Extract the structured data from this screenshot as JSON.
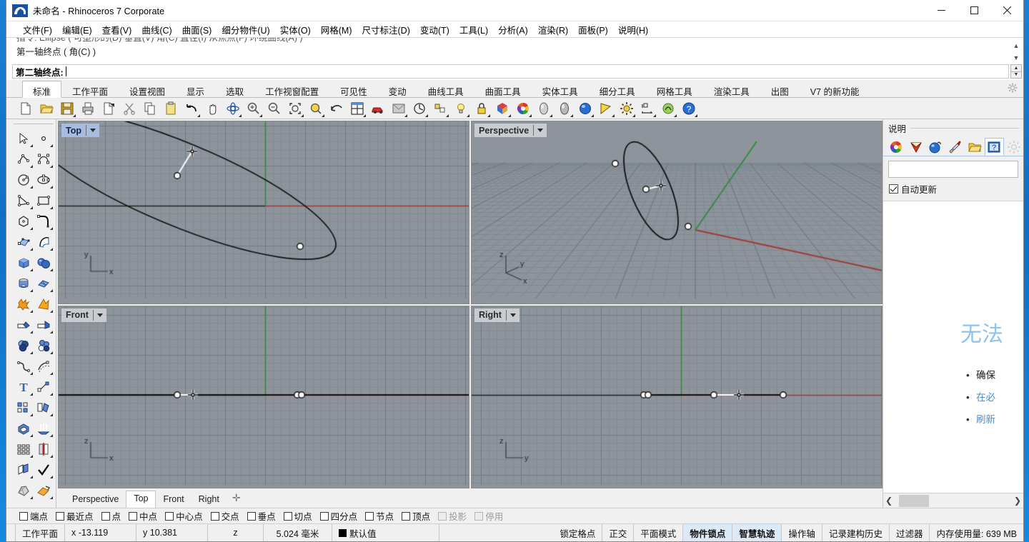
{
  "window": {
    "title": "未命名 - Rhinoceros 7 Corporate",
    "minimize": "—",
    "maximize": "□",
    "close": "✕"
  },
  "menubar": {
    "items": [
      {
        "label": "文件(F)",
        "name": "menu-file"
      },
      {
        "label": "编辑(E)",
        "name": "menu-edit"
      },
      {
        "label": "查看(V)",
        "name": "menu-view"
      },
      {
        "label": "曲线(C)",
        "name": "menu-curve"
      },
      {
        "label": "曲面(S)",
        "name": "menu-surface"
      },
      {
        "label": "细分物件(U)",
        "name": "menu-subd"
      },
      {
        "label": "实体(O)",
        "name": "menu-solid"
      },
      {
        "label": "网格(M)",
        "name": "menu-mesh"
      },
      {
        "label": "尺寸标注(D)",
        "name": "menu-dimension"
      },
      {
        "label": "变动(T)",
        "name": "menu-transform"
      },
      {
        "label": "工具(L)",
        "name": "menu-tools"
      },
      {
        "label": "分析(A)",
        "name": "menu-analyze"
      },
      {
        "label": "渲染(R)",
        "name": "menu-render"
      },
      {
        "label": "面板(P)",
        "name": "menu-panels"
      },
      {
        "label": "说明(H)",
        "name": "menu-help"
      }
    ]
  },
  "command": {
    "history_line1": "指令: Ellipse ( 可塑形的(D) 垂直(V) 角(C) 直径(I) 从焦点(F) 环绕曲线(A) )",
    "history_line2": "第一轴终点 ( 角(C) )",
    "prompt": "第二轴终点:",
    "input_value": ""
  },
  "ribbon": {
    "tabs": [
      {
        "label": "标准",
        "active": true
      },
      {
        "label": "工作平面",
        "active": false
      },
      {
        "label": "设置视图",
        "active": false
      },
      {
        "label": "显示",
        "active": false
      },
      {
        "label": "选取",
        "active": false
      },
      {
        "label": "工作视窗配置",
        "active": false
      },
      {
        "label": "可见性",
        "active": false
      },
      {
        "label": "变动",
        "active": false
      },
      {
        "label": "曲线工具",
        "active": false
      },
      {
        "label": "曲面工具",
        "active": false
      },
      {
        "label": "实体工具",
        "active": false
      },
      {
        "label": "细分工具",
        "active": false
      },
      {
        "label": "网格工具",
        "active": false
      },
      {
        "label": "渲染工具",
        "active": false
      },
      {
        "label": "出图",
        "active": false
      },
      {
        "label": "V7 的新功能",
        "active": false
      }
    ],
    "options_icon": "gear-icon"
  },
  "toolbar": {
    "buttons": [
      {
        "name": "new-file-icon",
        "flyout": false
      },
      {
        "name": "open-file-icon",
        "flyout": false
      },
      {
        "name": "save-file-icon",
        "flyout": true
      },
      {
        "name": "print-icon",
        "flyout": false
      },
      {
        "name": "export-icon",
        "flyout": false
      },
      {
        "name": "cut-icon",
        "flyout": false
      },
      {
        "name": "copy-icon",
        "flyout": false
      },
      {
        "name": "paste-icon",
        "flyout": false
      },
      {
        "name": "undo-icon",
        "flyout": true
      },
      {
        "name": "pan-icon",
        "flyout": false
      },
      {
        "name": "rotate-view-icon",
        "flyout": true
      },
      {
        "name": "zoom-in-icon",
        "flyout": true
      },
      {
        "name": "zoom-out-icon",
        "flyout": false
      },
      {
        "name": "zoom-extents-icon",
        "flyout": true
      },
      {
        "name": "zoom-selected-icon",
        "flyout": true
      },
      {
        "name": "zoom-previous-icon",
        "flyout": false
      },
      {
        "name": "four-viewport-icon",
        "flyout": true
      },
      {
        "name": "render-car-icon",
        "flyout": false
      },
      {
        "name": "render-preview-icon",
        "flyout": true
      },
      {
        "name": "layer-state-icon",
        "flyout": true
      },
      {
        "name": "selection-filter-icon",
        "flyout": true
      },
      {
        "name": "light-icon",
        "flyout": true
      },
      {
        "name": "lock-icon",
        "flyout": true
      },
      {
        "name": "material-icon",
        "flyout": true
      },
      {
        "name": "color-wheel-icon",
        "flyout": true
      },
      {
        "name": "sphere-gray-icon",
        "flyout": true
      },
      {
        "name": "sphere-shaded-icon",
        "flyout": true
      },
      {
        "name": "sphere-blue-icon",
        "flyout": true
      },
      {
        "name": "camera-icon",
        "flyout": true
      },
      {
        "name": "options-gear-icon",
        "flyout": true
      },
      {
        "name": "dimension-icon",
        "flyout": true
      },
      {
        "name": "grasshopper-icon",
        "flyout": true
      },
      {
        "name": "help-icon",
        "flyout": true
      }
    ]
  },
  "left_toolbar": {
    "groups": [
      [
        "select-arrow-icon",
        "point-icon"
      ],
      [
        "polyline-icon",
        "curve-interp-icon"
      ],
      [
        "circle-icon",
        "ellipse-icon"
      ],
      [
        "arc-icon",
        "rectangle-icon"
      ],
      [
        "polygon-icon",
        "fillet-curve-icon"
      ],
      [
        "surface-srf-pt-icon",
        "loft-surface-icon"
      ],
      [
        "box-solid-icon",
        "sphere-solid-icon"
      ],
      [
        "cylinder-solid-icon",
        "subd-plane-icon"
      ],
      [
        "explode-icon",
        "split-icon"
      ],
      [
        "trim-icon",
        "extend-icon"
      ],
      [
        "boolean-union-icon",
        "boolean-diff-icon"
      ],
      [
        "blend-curve-icon",
        "offset-curve-icon"
      ],
      [
        "text-tool-icon",
        "control-points-icon"
      ],
      [
        "group-objects-icon",
        "copy-objects-icon"
      ],
      [
        "cap-holes-icon",
        "extrude-surface-icon"
      ],
      [
        "array-icon",
        "mirror-icon"
      ],
      [
        "layer-tools-icon",
        "check-objects-icon"
      ],
      [
        "mesh-from-nurbs-icon",
        "render-material-icon"
      ]
    ]
  },
  "viewports": [
    {
      "name": "top",
      "label": "Top",
      "active": true,
      "has_world_axis": true,
      "axis_labels": [
        "y",
        "x"
      ]
    },
    {
      "name": "perspective",
      "label": "Perspective",
      "active": false,
      "has_world_axis": true,
      "axis_labels": [
        "z",
        "y",
        "x"
      ]
    },
    {
      "name": "front",
      "label": "Front",
      "active": false,
      "has_world_axis": true,
      "axis_labels": [
        "z",
        "x"
      ]
    },
    {
      "name": "right",
      "label": "Right",
      "active": false,
      "has_world_axis": true,
      "axis_labels": [
        "z",
        "y"
      ]
    }
  ],
  "viewport_tabs": {
    "items": [
      {
        "label": "Perspective",
        "active": false
      },
      {
        "label": "Top",
        "active": true
      },
      {
        "label": "Front",
        "active": false
      },
      {
        "label": "Right",
        "active": false
      }
    ],
    "add_label": "✛"
  },
  "right_panel": {
    "title": "说明",
    "tabs": [
      {
        "name": "tab-color-wheel",
        "active": false
      },
      {
        "name": "tab-material-shield",
        "active": false
      },
      {
        "name": "tab-environment-sphere",
        "active": false
      },
      {
        "name": "tab-paint-brush",
        "active": false
      },
      {
        "name": "tab-folder",
        "active": false
      },
      {
        "name": "tab-help",
        "active": true
      },
      {
        "name": "tab-gear",
        "active": false
      }
    ],
    "search_value": "",
    "search_placeholder": "",
    "autoupdate_label": "自动更新",
    "autoupdate_checked": true,
    "doc_heading": "无法",
    "doc_items": [
      {
        "text": "确保",
        "is_link": false
      },
      {
        "text": "在必",
        "is_link": true
      },
      {
        "text": "刷新",
        "is_link": true
      }
    ],
    "scroll_left": "❮",
    "scroll_right": "❯"
  },
  "osnap": {
    "items": [
      {
        "label": "端点",
        "checked": false,
        "disabled": false
      },
      {
        "label": "最近点",
        "checked": false,
        "disabled": false
      },
      {
        "label": "点",
        "checked": false,
        "disabled": false
      },
      {
        "label": "中点",
        "checked": false,
        "disabled": false
      },
      {
        "label": "中心点",
        "checked": false,
        "disabled": false
      },
      {
        "label": "交点",
        "checked": false,
        "disabled": false
      },
      {
        "label": "垂点",
        "checked": false,
        "disabled": false
      },
      {
        "label": "切点",
        "checked": false,
        "disabled": false
      },
      {
        "label": "四分点",
        "checked": false,
        "disabled": false
      },
      {
        "label": "节点",
        "checked": false,
        "disabled": false
      },
      {
        "label": "顶点",
        "checked": false,
        "disabled": false
      },
      {
        "label": "投影",
        "checked": false,
        "disabled": true
      },
      {
        "label": "停用",
        "checked": false,
        "disabled": true
      }
    ]
  },
  "statusbar": {
    "cplane_label": "工作平面",
    "x_value": "x -13.119",
    "y_value": "y 10.381",
    "z_value": "z",
    "units": "5.024 毫米",
    "layer": "默认值",
    "layer_color": "#000000",
    "toggles": [
      {
        "label": "锁定格点",
        "on": false
      },
      {
        "label": "正交",
        "on": false
      },
      {
        "label": "平面模式",
        "on": false
      },
      {
        "label": "物件锁点",
        "on": true
      },
      {
        "label": "智慧轨迹",
        "on": true
      },
      {
        "label": "操作轴",
        "on": false
      },
      {
        "label": "记录建构历史",
        "on": false
      },
      {
        "label": "过滤器",
        "on": false
      }
    ],
    "memory": "内存使用量: 639 MB"
  },
  "colors": {
    "viewport_bg": "#8d949c",
    "grid_minor": "#868d95",
    "grid_major": "#7b828a",
    "axis_x": "#a03a3a",
    "axis_y": "#2f8c3a",
    "curve": "#111111",
    "rubber_band": "#ffffff",
    "accent_blue": "#0a6cc4",
    "help_heading": "#8ec2ef",
    "link": "#4b8ed6"
  }
}
